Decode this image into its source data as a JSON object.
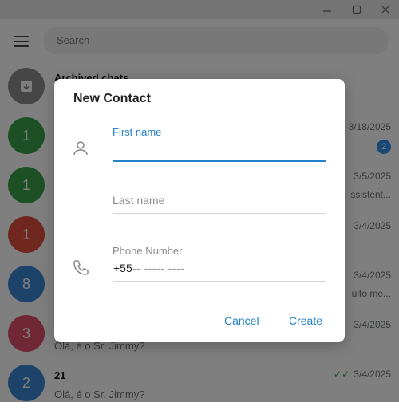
{
  "window": {
    "minimize_icon": "minimize-icon",
    "maximize_icon": "maximize-icon",
    "close_icon": "close-icon"
  },
  "sidebar": {
    "search_placeholder": "Search",
    "archived_label": "Archived chats",
    "chats": [
      {
        "avatar": "1",
        "color": "#3aa34a",
        "date": "3/18/2025",
        "badge": "2"
      },
      {
        "avatar": "1",
        "color": "#3aa34a",
        "date": "3/5/2025",
        "preview": "ssistent..."
      },
      {
        "avatar": "1",
        "color": "#e04f3e",
        "date": "3/4/2025"
      },
      {
        "avatar": "8",
        "color": "#3d86d6",
        "date": "3/4/2025",
        "preview": "uito me..."
      },
      {
        "avatar": "3",
        "color": "#e0506e",
        "date": "3/4/2025",
        "message": "Olá, é o Sr. Jimmy?"
      },
      {
        "avatar": "2",
        "color": "#3d86d6",
        "name": "21",
        "date": "3/4/2025",
        "message": "Olá, é o Sr. Jimmy?"
      }
    ]
  },
  "dialog": {
    "title": "New Contact",
    "first_name_label": "First name",
    "first_name_value": "",
    "last_name_placeholder": "Last name",
    "phone_label": "Phone Number",
    "phone_prefix": "+55",
    "phone_mask": "-- ----- ----",
    "cancel_label": "Cancel",
    "create_label": "Create"
  },
  "colors": {
    "accent": "#2481cc",
    "overlay": "rgba(0,0,0,0.5)"
  }
}
